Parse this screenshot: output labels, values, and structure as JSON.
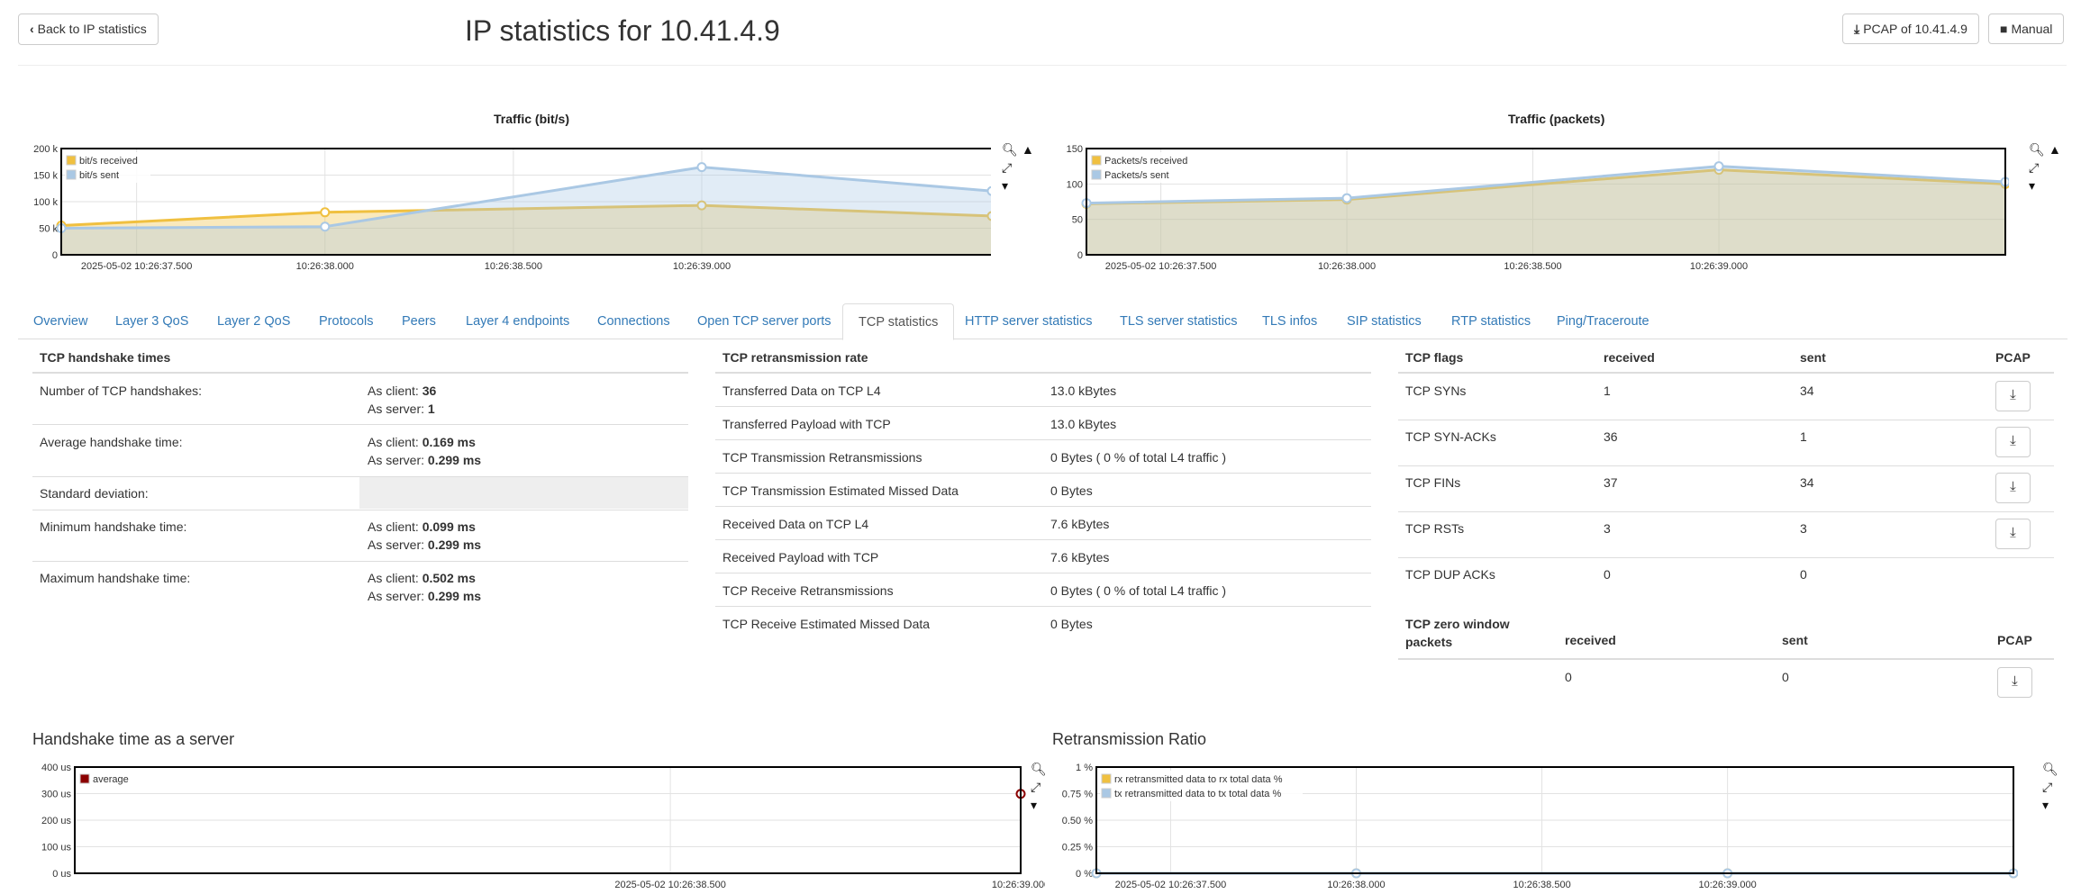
{
  "header": {
    "back_label": "Back to IP statistics",
    "title": "IP statistics for 10.41.4.9",
    "pcap_label": "PCAP of 10.41.4.9",
    "manual_label": "Manual"
  },
  "icons": {
    "back": "chevron-left-icon",
    "download": "download-icon",
    "book": "book-icon",
    "zoom": "magnifier-icon",
    "area": "area-chart-icon",
    "reset_zoom": "compress-icon",
    "menu": "caret-down-icon"
  },
  "tabs": [
    {
      "label": "Overview"
    },
    {
      "label": "Layer 3 QoS"
    },
    {
      "label": "Layer 2 QoS"
    },
    {
      "label": "Protocols"
    },
    {
      "label": "Peers"
    },
    {
      "label": "Layer 4 endpoints"
    },
    {
      "label": "Connections"
    },
    {
      "label": "Open TCP server ports"
    },
    {
      "label": "TCP statistics",
      "active": true
    },
    {
      "label": "HTTP server statistics"
    },
    {
      "label": "TLS server statistics"
    },
    {
      "label": "TLS infos"
    },
    {
      "label": "SIP statistics"
    },
    {
      "label": "RTP statistics"
    },
    {
      "label": "Ping/Traceroute"
    }
  ],
  "handshake": {
    "heading": "TCP handshake times",
    "rows": [
      {
        "label": "Number of TCP handshakes:",
        "client_prefix": "As client: ",
        "client": "36",
        "server_prefix": "As server: ",
        "server": "1"
      },
      {
        "label": "Average handshake time:",
        "client_prefix": "As client: ",
        "client": "0.169 ms",
        "server_prefix": "As server: ",
        "server": "0.299 ms"
      },
      {
        "label": "Standard deviation:"
      },
      {
        "label": "Minimum handshake time:",
        "client_prefix": "As client: ",
        "client": "0.099 ms",
        "server_prefix": "As server: ",
        "server": "0.299 ms"
      },
      {
        "label": "Maximum handshake time:",
        "client_prefix": "As client: ",
        "client": "0.502 ms",
        "server_prefix": "As server: ",
        "server": "0.299 ms"
      }
    ]
  },
  "retransmission": {
    "heading": "TCP retransmission rate",
    "rows": [
      {
        "label": "Transferred Data on TCP L4",
        "value": "13.0 kBytes"
      },
      {
        "label": "Transferred Payload with TCP",
        "value": "13.0 kBytes"
      },
      {
        "label": "TCP Transmission Retransmissions",
        "value": "0 Bytes ( 0 % of total L4 traffic )"
      },
      {
        "label": "TCP Transmission Estimated Missed Data",
        "value": "0 Bytes"
      },
      {
        "label": "Received Data on TCP L4",
        "value": "7.6 kBytes"
      },
      {
        "label": "Received Payload with TCP",
        "value": "7.6 kBytes"
      },
      {
        "label": "TCP Receive Retransmissions",
        "value": "0 Bytes ( 0 % of total L4 traffic )"
      },
      {
        "label": "TCP Receive Estimated Missed Data",
        "value": "0 Bytes"
      }
    ]
  },
  "flags": {
    "headers": [
      "TCP flags",
      "received",
      "sent",
      "PCAP"
    ],
    "rows": [
      {
        "name": "TCP SYNs",
        "received": "1",
        "sent": "34",
        "pcap": true
      },
      {
        "name": "TCP SYN-ACKs",
        "received": "36",
        "sent": "1",
        "pcap": true
      },
      {
        "name": "TCP FINs",
        "received": "37",
        "sent": "34",
        "pcap": true
      },
      {
        "name": "TCP RSTs",
        "received": "3",
        "sent": "3",
        "pcap": true
      },
      {
        "name": "TCP DUP ACKs",
        "received": "0",
        "sent": "0",
        "pcap": false
      }
    ]
  },
  "zero_window": {
    "headers": [
      "TCP zero window packets",
      "received",
      "sent",
      "PCAP"
    ],
    "row": {
      "received": "0",
      "sent": "0"
    }
  },
  "chart_data": [
    {
      "type": "area",
      "title": "Traffic (bit/s)",
      "x": [
        "2025-05-02 10:26:37.300",
        "2025-05-02 10:26:38.000",
        "2025-05-02 10:26:39.000",
        "2025-05-02 10:26:39.770"
      ],
      "x_ticks": [
        "2025-05-02 10:26:37.500",
        "10:26:38.000",
        "10:26:38.500",
        "10:26:39.000"
      ],
      "y_ticks": [
        "0",
        "50 k",
        "100 k",
        "150 k",
        "200 k"
      ],
      "ylim": [
        0,
        200000
      ],
      "series": [
        {
          "name": "bit/s received",
          "color": "#f0c040",
          "values": [
            55000,
            80000,
            93000,
            73000
          ]
        },
        {
          "name": "bit/s sent",
          "color": "#aac8e4",
          "values": [
            50000,
            53000,
            165000,
            120000
          ]
        }
      ],
      "legend": "top-left",
      "grid": true
    },
    {
      "type": "area",
      "title": "Traffic (packets)",
      "x": [
        "2025-05-02 10:26:37.300",
        "2025-05-02 10:26:38.000",
        "2025-05-02 10:26:39.000",
        "2025-05-02 10:26:39.770"
      ],
      "x_ticks": [
        "2025-05-02 10:26:37.500",
        "10:26:38.000",
        "10:26:38.500",
        "10:26:39.000"
      ],
      "y_ticks": [
        "0",
        "50",
        "100",
        "150"
      ],
      "ylim": [
        0,
        150
      ],
      "series": [
        {
          "name": "Packets/s received",
          "color": "#f0c040",
          "values": [
            72,
            78,
            120,
            100
          ]
        },
        {
          "name": "Packets/s sent",
          "color": "#aac8e4",
          "values": [
            73,
            80,
            125,
            103
          ]
        }
      ],
      "legend": "top-left",
      "grid": true
    },
    {
      "type": "scatter",
      "title": "Handshake time as a server",
      "x": [
        "2025-05-02 10:26:39.000"
      ],
      "x_ticks": [
        "2025-05-02 10:26:38.500",
        "10:26:39.000"
      ],
      "y_ticks": [
        "0 us",
        "100 us",
        "200 us",
        "300 us",
        "400 us"
      ],
      "ylim": [
        0,
        400
      ],
      "series": [
        {
          "name": "average",
          "color": "#8b0000",
          "values": [
            299
          ]
        }
      ],
      "legend": "top-left",
      "grid": true
    },
    {
      "type": "line",
      "title": "Retransmission Ratio",
      "x": [
        "2025-05-02 10:26:37.300",
        "2025-05-02 10:26:38.000",
        "2025-05-02 10:26:39.000",
        "2025-05-02 10:26:39.770"
      ],
      "x_ticks": [
        "2025-05-02 10:26:37.500",
        "10:26:38.000",
        "10:26:38.500",
        "10:26:39.000"
      ],
      "y_ticks": [
        "0 %",
        "0.25 %",
        "0.50 %",
        "0.75 %",
        "1 %"
      ],
      "ylim": [
        0,
        1
      ],
      "series": [
        {
          "name": "rx retransmitted data to rx total data %",
          "color": "#f0c040",
          "values": [
            0,
            0,
            0,
            0
          ]
        },
        {
          "name": "tx retransmitted data to tx total data %",
          "color": "#aac8e4",
          "values": [
            0,
            0,
            0,
            0
          ]
        }
      ],
      "legend": "top-left",
      "grid": true
    }
  ]
}
